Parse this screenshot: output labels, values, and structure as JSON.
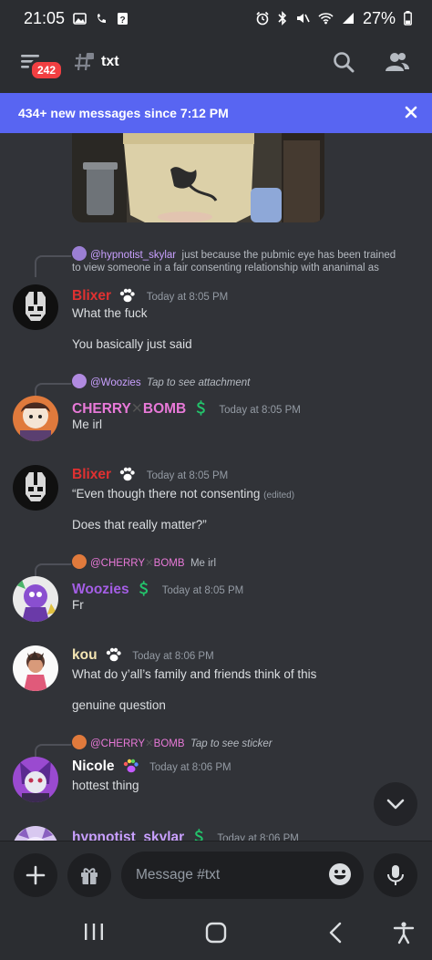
{
  "status_bar": {
    "time": "21:05",
    "battery": "27%"
  },
  "header": {
    "badge_count": "242",
    "channel_name": "txt"
  },
  "new_messages_bar": {
    "text": "434+ new messages since 7:12 PM"
  },
  "messages": [
    {
      "reply": {
        "name": "@hypnotist_skylar",
        "text": "just because  the pubmic eye has been trained",
        "text2": "to view someone  in a fair consenting  relationship  with ananimal as"
      },
      "author": "Blixer",
      "author_color": "#e03131",
      "timestamp": "Today at 8:05 PM",
      "lines": [
        "What the fuck",
        "You basically just said"
      ]
    },
    {
      "reply": {
        "name": "@Woozies",
        "text": "Tap to see attachment"
      },
      "author": "CHERRY",
      "author2": "BOMB",
      "author_color": "#e879d8",
      "timestamp": "Today at 8:05 PM",
      "lines": [
        "Me irl"
      ]
    },
    {
      "author": "Blixer",
      "author_color": "#e03131",
      "timestamp": "Today at 8:05 PM",
      "lines": [
        "“Even though there not consenting",
        "Does that really matter?”"
      ],
      "edited": "(edited)"
    },
    {
      "reply": {
        "name": "@CHERRY",
        "name2": "BOMB",
        "text": "Me irl"
      },
      "author": "Woozies",
      "author_color": "#a45ee5",
      "timestamp": "Today at 8:05 PM",
      "lines": [
        "Fr"
      ]
    },
    {
      "author": "kou",
      "author_color": "#f5e6b3",
      "timestamp": "Today at 8:06 PM",
      "lines": [
        "What do y’all’s family and friends think of this",
        "genuine question"
      ]
    },
    {
      "reply": {
        "name": "@CHERRY",
        "name2": "BOMB",
        "text": "Tap to see sticker"
      },
      "author": "Nicole",
      "author_color": "#ffffff",
      "timestamp": "Today at 8:06 PM",
      "lines": [
        "hottest thing"
      ]
    },
    {
      "author": "hypnotist_skylar",
      "author_color": "#c9a0ff",
      "timestamp": "Today at 8:06 PM",
      "lines": []
    }
  ],
  "composer": {
    "placeholder": "Message #txt"
  },
  "icons": {
    "menu": "hamburger-icon",
    "channel": "hashtag-lock-icon",
    "search": "search-icon",
    "members": "members-icon",
    "close": "close-icon",
    "add": "plus-icon",
    "gift": "gift-icon",
    "emoji": "emoji-icon",
    "mic": "mic-icon",
    "scroll": "chevron-down-icon",
    "paw": "paw-icon",
    "nitro": "dollar-icon"
  }
}
